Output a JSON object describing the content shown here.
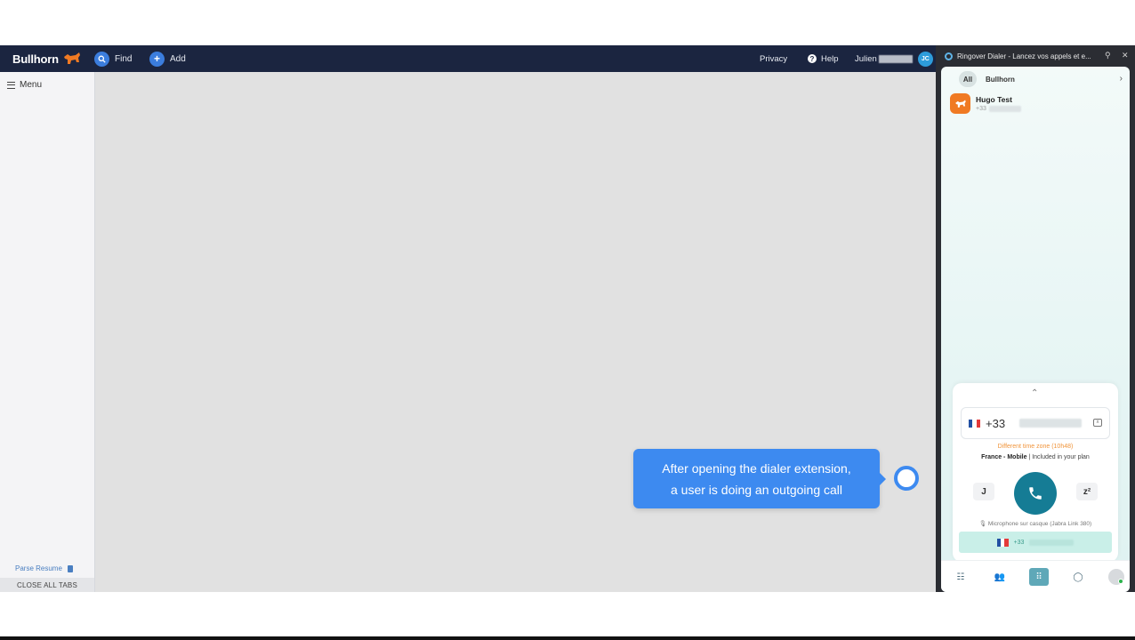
{
  "bullhorn": {
    "logo": "Bullhorn",
    "find_label": "Find",
    "add_label": "Add",
    "privacy_label": "Privacy",
    "help_label": "Help",
    "user_name": "Julien",
    "user_initials": "JC",
    "menu_label": "Menu",
    "parse_resume_label": "Parse Resume",
    "close_all_tabs_label": "CLOSE ALL TABS"
  },
  "tooltip": {
    "line1": "After opening the dialer extension,",
    "line2": "a user is doing an outgoing call"
  },
  "extension": {
    "title": "Ringover Dialer - Lancez vos appels et e...",
    "tabs": {
      "all": "All",
      "bullhorn": "Bullhorn"
    },
    "contact": {
      "name": "Hugo Test",
      "number_prefix": "+33"
    },
    "dialpad": {
      "country_code": "+33",
      "timezone_note": "Different time zone (10h48)",
      "line_type": "France - Mobile",
      "plan_note": "Included in your plan",
      "left_button": "J",
      "right_button": "z²",
      "microphone": "Microphone sur casque (Jabra Link 380)",
      "recent_prefix": "+33"
    }
  },
  "colors": {
    "topbar": "#1b2540",
    "accent": "#3d8af0",
    "call_button": "#157c95",
    "bullhorn_orange": "#f07a23"
  },
  "icons": [
    "search-icon",
    "plus-icon",
    "help-icon",
    "hamburger-icon",
    "document-icon",
    "pin-icon",
    "close-icon",
    "chevron-right-icon",
    "chevron-up-icon",
    "backspace-icon",
    "phone-icon",
    "microphone-icon",
    "list-icon",
    "contacts-icon",
    "dialpad-icon",
    "chat-icon",
    "profile-icon"
  ]
}
